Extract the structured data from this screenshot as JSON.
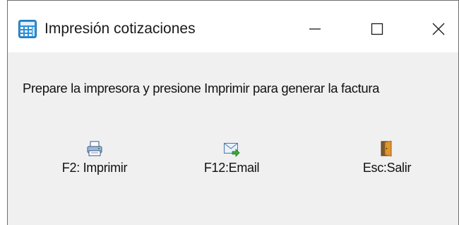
{
  "window": {
    "title": "Impresión cotizaciones",
    "app_icon": "calculator-app-icon",
    "controls": {
      "minimize": "minimize-icon",
      "maximize": "maximize-icon",
      "close": "close-icon"
    }
  },
  "message": "Prepare la impresora y presione Imprimir para generar la factura",
  "actions": [
    {
      "label": "F2: Imprimir",
      "icon": "printer-icon"
    },
    {
      "label": "F12:Email",
      "icon": "email-send-icon"
    },
    {
      "label": "Esc:Salir",
      "icon": "exit-door-icon"
    }
  ],
  "colors": {
    "client_bg": "#f0f0f0",
    "titlebar_bg": "#ffffff",
    "border": "#6f6f6f",
    "text": "#111111"
  }
}
